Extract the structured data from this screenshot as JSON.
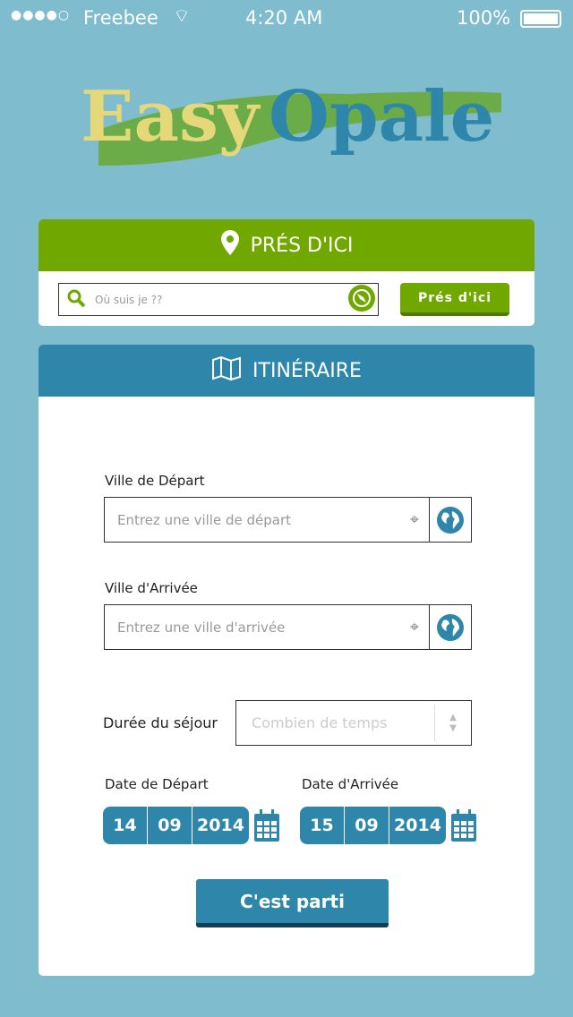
{
  "status": {
    "carrier": "Freebee",
    "time": "4:20 AM",
    "battery": "100%"
  },
  "logo": {
    "word1": "Easy",
    "word2": "Opale"
  },
  "nearby": {
    "title": "PRÉS D'ICI",
    "search_placeholder": "Où suis je ??",
    "button": "Prés d'ici"
  },
  "itinerary": {
    "title": "ITINÉRAIRE",
    "departure_label": "Ville de Départ",
    "departure_placeholder": "Entrez une ville de départ",
    "arrival_label": "Ville d'Arrivée",
    "arrival_placeholder": "Entrez une ville d'arrivée",
    "duration_label": "Durée du séjour",
    "duration_placeholder": "Combien de temps",
    "date_departure_label": "Date de Départ",
    "date_departure": {
      "day": "14",
      "month": "09",
      "year": "2014"
    },
    "date_arrival_label": "Date d'Arrivée",
    "date_arrival": {
      "day": "15",
      "month": "09",
      "year": "2014"
    },
    "submit": "C'est parti"
  },
  "colors": {
    "green": "#70a800",
    "blue": "#2e87aa",
    "bg": "#7fbccd"
  }
}
